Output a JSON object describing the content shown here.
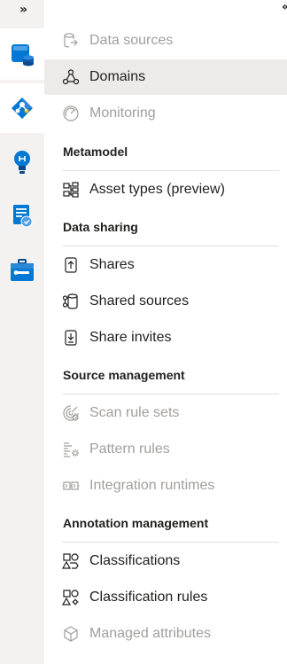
{
  "rail": {
    "expand_glyph": "»",
    "icons": [
      {
        "name": "data-map-icon",
        "active": true
      },
      {
        "name": "data-catalog-icon",
        "active": true
      },
      {
        "name": "insights-icon",
        "active": false
      },
      {
        "name": "policy-icon",
        "active": false
      },
      {
        "name": "management-icon",
        "active": false
      }
    ]
  },
  "panel": {
    "collapse_glyph": "«",
    "items": {
      "data_sources": "Data sources",
      "domains": "Domains",
      "monitoring": "Monitoring",
      "asset_types": "Asset types (preview)",
      "shares": "Shares",
      "shared_sources": "Shared sources",
      "share_invites": "Share invites",
      "scan_rule_sets": "Scan rule sets",
      "pattern_rules": "Pattern rules",
      "integration_runtimes": "Integration runtimes",
      "classifications": "Classifications",
      "classification_rules": "Classification rules",
      "managed_attributes": "Managed attributes"
    },
    "sections": {
      "metamodel": "Metamodel",
      "data_sharing": "Data sharing",
      "source_management": "Source management",
      "annotation_management": "Annotation management"
    },
    "selected_item": "Domains",
    "colors": {
      "selected_bg": "#edebe9",
      "disabled_text": "#a19f9d",
      "accent_blue": "#0078d4"
    }
  }
}
